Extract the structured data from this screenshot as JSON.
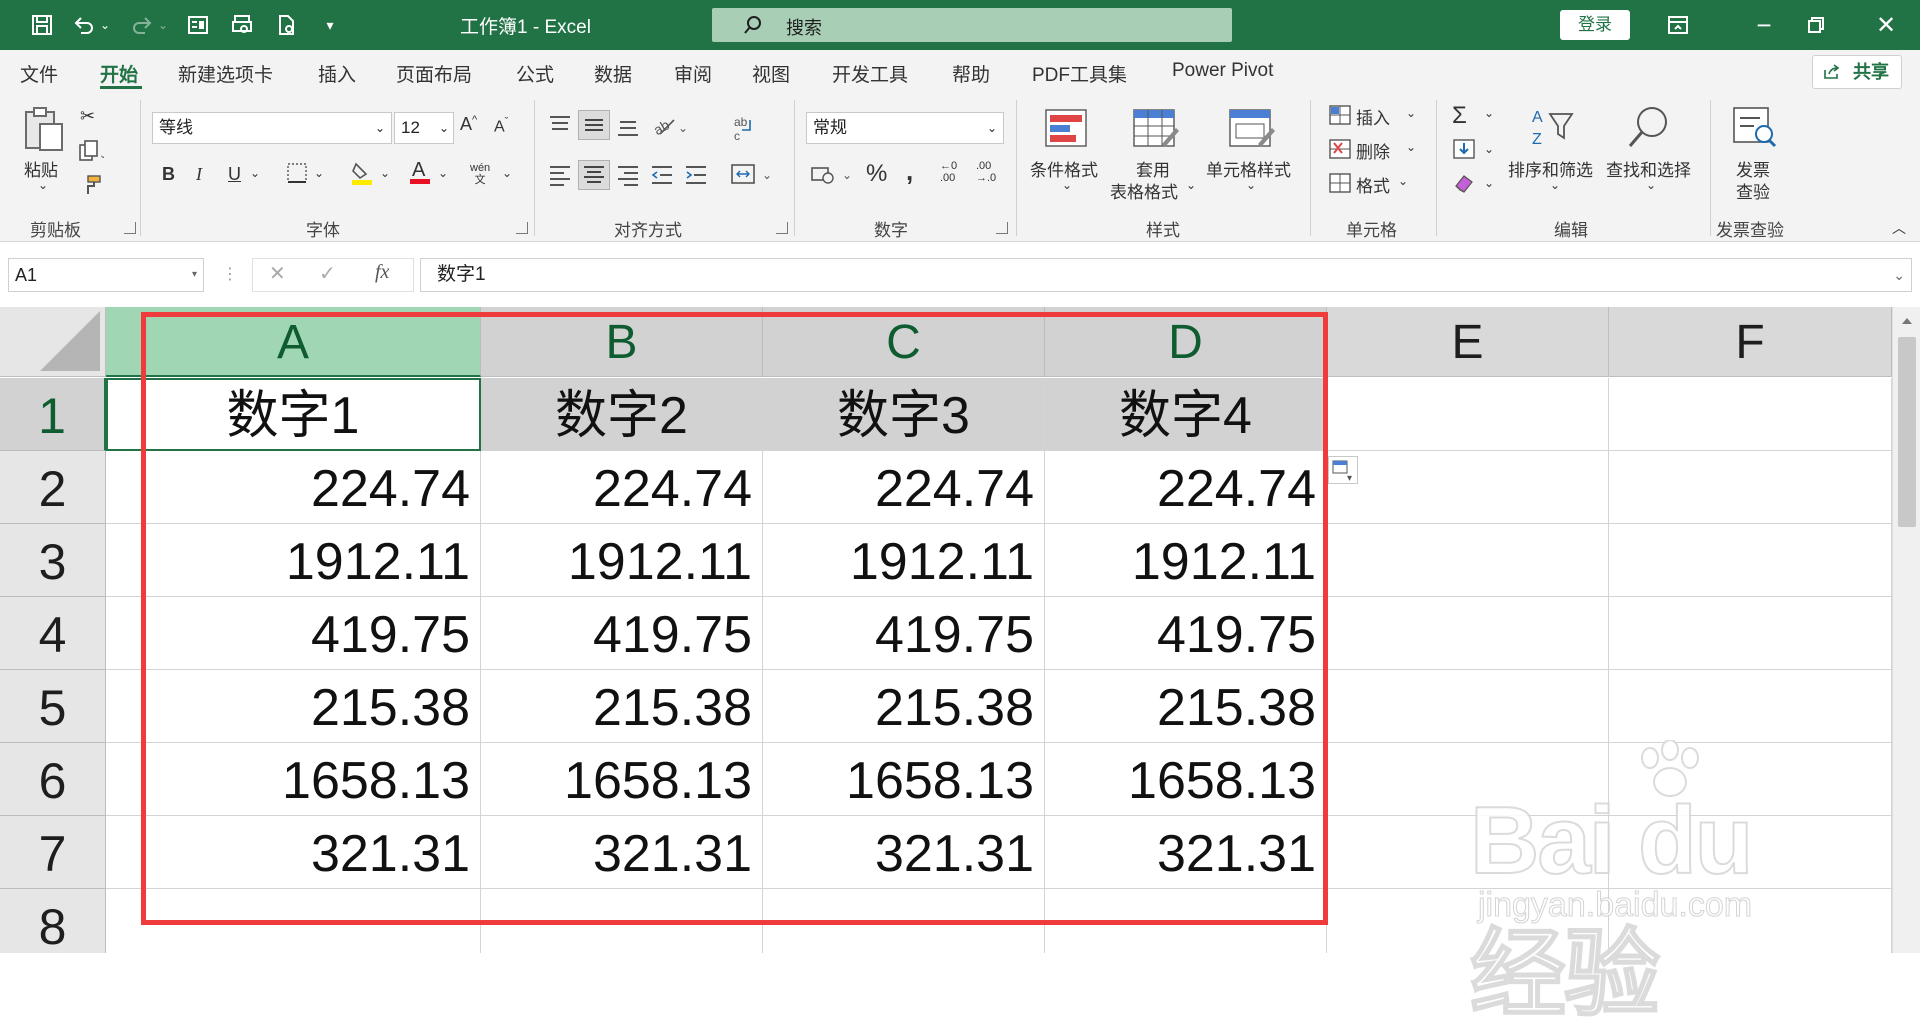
{
  "window": {
    "title": "工作簿1  -  Excel",
    "search_placeholder": "搜索",
    "login_label": "登录"
  },
  "menu": {
    "tabs": [
      "文件",
      "开始",
      "新建选项卡",
      "插入",
      "页面布局",
      "公式",
      "数据",
      "审阅",
      "视图",
      "开发工具",
      "帮助",
      "PDF工具集",
      "Power Pivot"
    ],
    "active": "开始",
    "share_label": "共享"
  },
  "ribbon": {
    "clipboard": {
      "label": "剪贴板",
      "paste": "粘贴"
    },
    "font": {
      "label": "字体",
      "name": "等线",
      "size": "12",
      "bold": "B",
      "italic": "I",
      "underline": "U"
    },
    "alignment": {
      "label": "对齐方式"
    },
    "number": {
      "label": "数字",
      "format": "常规",
      "percent": "%"
    },
    "styles": {
      "label": "样式",
      "conditional": "条件格式",
      "table_line1": "套用",
      "table_line2": "表格格式",
      "cell_styles": "单元格样式"
    },
    "cells": {
      "label": "单元格",
      "insert": "插入",
      "delete": "删除",
      "format": "格式"
    },
    "editing": {
      "label": "编辑",
      "sort": "排序和筛选",
      "find": "查找和选择"
    },
    "invoice": {
      "label": "发票查验",
      "line1": "发票",
      "line2": "查验"
    }
  },
  "formula_bar": {
    "name_box": "A1",
    "fx": "fx",
    "content": "数字1"
  },
  "sheet": {
    "columns": [
      "A",
      "B",
      "C",
      "D",
      "E",
      "F"
    ],
    "rows": [
      "1",
      "2",
      "3",
      "4",
      "5",
      "6",
      "7",
      "8"
    ],
    "headers": [
      "数字1",
      "数字2",
      "数字3",
      "数字4"
    ],
    "values": [
      [
        "224.74",
        "224.74",
        "224.74",
        "224.74"
      ],
      [
        "1912.11",
        "1912.11",
        "1912.11",
        "1912.11"
      ],
      [
        "419.75",
        "419.75",
        "419.75",
        "419.75"
      ],
      [
        "215.38",
        "215.38",
        "215.38",
        "215.38"
      ],
      [
        "1658.13",
        "1658.13",
        "1658.13",
        "1658.13"
      ],
      [
        "321.31",
        "321.31",
        "321.31",
        "321.31"
      ]
    ],
    "selected_cell": "A1",
    "highlight_color": "#ef3b3b"
  },
  "watermark": {
    "logo": "Bai du 经验",
    "url": "jingyan.baidu.com"
  },
  "colors": {
    "excel_green": "#217346",
    "selection_header": "#a0d6b4"
  }
}
